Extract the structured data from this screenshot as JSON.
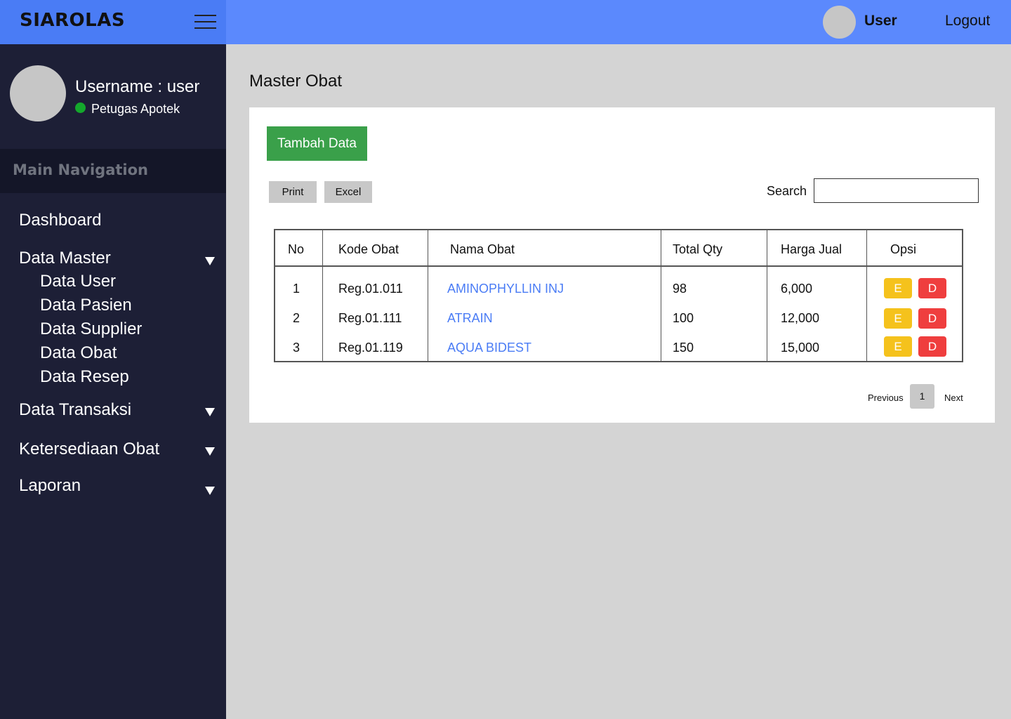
{
  "brand": {
    "title": "SIAROLAS"
  },
  "topbar": {
    "user_label": "User",
    "logout_label": "Logout"
  },
  "sidebar": {
    "username": "Username : user",
    "role": "Petugas Apotek",
    "nav_header": "Main Navigation",
    "items": [
      {
        "label": "Dashboard"
      },
      {
        "label": "Data Master",
        "expanded": true,
        "children": [
          "Data User",
          "Data Pasien",
          "Data Supplier",
          "Data Obat",
          "Data Resep"
        ]
      },
      {
        "label": "Data Transaksi",
        "expanded": false
      },
      {
        "label": "Ketersediaan Obat",
        "expanded": false
      },
      {
        "label": "Laporan",
        "expanded": false
      }
    ]
  },
  "main": {
    "page_title": "Master Obat",
    "add_button": "Tambah Data",
    "print_button": "Print",
    "excel_button": "Excel",
    "search_label": "Search",
    "search_value": "",
    "table": {
      "headers": [
        "No",
        "Kode Obat",
        "Nama Obat",
        "Total Qty",
        "Harga Jual",
        "Opsi"
      ],
      "rows": [
        {
          "no": "1",
          "kode": "Reg.01.011",
          "nama": "AMINOPHYLLIN INJ",
          "qty": "98",
          "harga": "6,000",
          "edit": "E",
          "delete": "D"
        },
        {
          "no": "2",
          "kode": "Reg.01.111",
          "nama": "ATRAIN",
          "qty": "100",
          "harga": "12,000",
          "edit": "E",
          "delete": "D"
        },
        {
          "no": "3",
          "kode": "Reg.01.119",
          "nama": "AQUA BIDEST",
          "qty": "150",
          "harga": "15,000",
          "edit": "E",
          "delete": "D"
        }
      ]
    },
    "pagination": {
      "previous": "Previous",
      "current_page": "1",
      "next": "Next"
    }
  },
  "colors": {
    "brand_bg": "#4a7cf5",
    "topbar_bg": "#5b89fd",
    "sidebar_bg": "#1d1f36",
    "add_button": "#3aa04a",
    "edit_button": "#f5c21c",
    "delete_button": "#ef3e3e",
    "link": "#4a7cf5",
    "status_online": "#14a82c"
  },
  "icons": {
    "menu": "hamburger-menu-icon",
    "expand": "caret-down-icon",
    "status": "online-status-icon"
  }
}
